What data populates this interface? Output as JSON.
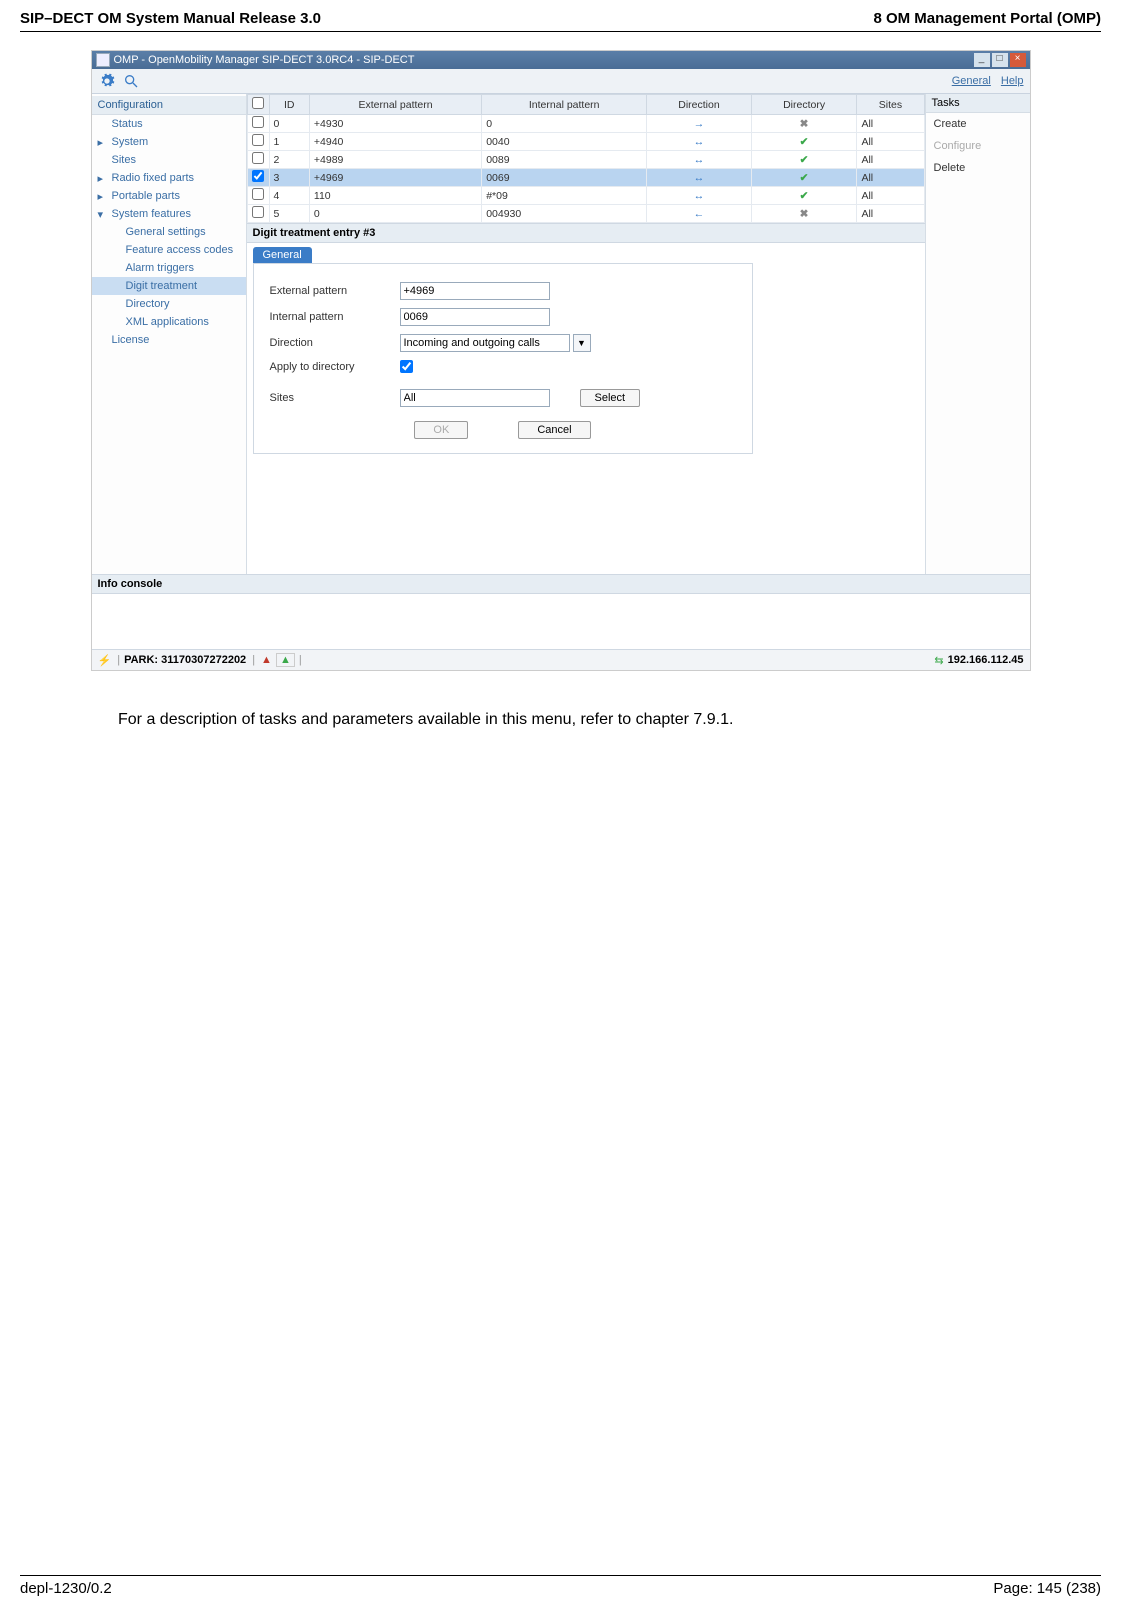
{
  "doc": {
    "header_left": "SIP–DECT OM System Manual Release 3.0",
    "header_right": "8 OM Management Portal (OMP)",
    "footer_left": "depl-1230/0.2",
    "footer_right": "Page: 145 (238)"
  },
  "window": {
    "title": "OMP - OpenMobility Manager SIP-DECT 3.0RC4 - SIP-DECT"
  },
  "toprow": {
    "general": "General",
    "help": "Help"
  },
  "sidebar": {
    "heading": "Configuration",
    "items": [
      {
        "label": "Status",
        "type": "item"
      },
      {
        "label": "System",
        "type": "exp"
      },
      {
        "label": "Sites",
        "type": "item"
      },
      {
        "label": "Radio fixed parts",
        "type": "exp"
      },
      {
        "label": "Portable parts",
        "type": "exp"
      },
      {
        "label": "System features",
        "type": "open"
      }
    ],
    "subs": [
      {
        "label": "General settings"
      },
      {
        "label": "Feature access codes"
      },
      {
        "label": "Alarm triggers"
      },
      {
        "label": "Digit treatment",
        "sel": true
      },
      {
        "label": "Directory"
      },
      {
        "label": "XML applications"
      }
    ],
    "license": "License"
  },
  "table": {
    "cols": [
      "",
      "ID",
      "External pattern",
      "Internal pattern",
      "Direction",
      "Directory",
      "Sites"
    ],
    "rows": [
      {
        "chk": false,
        "id": "0",
        "ext": "+4930",
        "int": "0",
        "dir": "→",
        "dirm": "x",
        "site": "All"
      },
      {
        "chk": false,
        "id": "1",
        "ext": "+4940",
        "int": "0040",
        "dir": "↔",
        "dirm": "v",
        "site": "All"
      },
      {
        "chk": false,
        "id": "2",
        "ext": "+4989",
        "int": "0089",
        "dir": "↔",
        "dirm": "v",
        "site": "All"
      },
      {
        "chk": true,
        "id": "3",
        "ext": "+4969",
        "int": "0069",
        "dir": "↔",
        "dirm": "v",
        "site": "All",
        "sel": true
      },
      {
        "chk": false,
        "id": "4",
        "ext": "110",
        "int": "#*09",
        "dir": "↔",
        "dirm": "v",
        "site": "All"
      },
      {
        "chk": false,
        "id": "5",
        "ext": "0",
        "int": "004930",
        "dir": "←",
        "dirm": "x",
        "site": "All"
      }
    ]
  },
  "tasks": {
    "heading": "Tasks",
    "items": [
      {
        "label": "Create",
        "dis": false
      },
      {
        "label": "Configure",
        "dis": true
      },
      {
        "label": "Delete",
        "dis": false
      }
    ]
  },
  "detail": {
    "title": "Digit treatment entry #3",
    "tab": "General",
    "fields": {
      "ext_label": "External pattern",
      "ext_value": "+4969",
      "int_label": "Internal pattern",
      "int_value": "0069",
      "dir_label": "Direction",
      "dir_value": "Incoming and outgoing calls",
      "apply_label": "Apply to directory",
      "sites_label": "Sites",
      "sites_value": "All",
      "select_btn": "Select"
    },
    "ok": "OK",
    "cancel": "Cancel"
  },
  "info": {
    "title": "Info console"
  },
  "status": {
    "park": "PARK: 31170307272202",
    "ip": "192.166.112.45"
  },
  "description": "For a description of tasks and parameters available in this menu, refer to chapter 7.9.1."
}
